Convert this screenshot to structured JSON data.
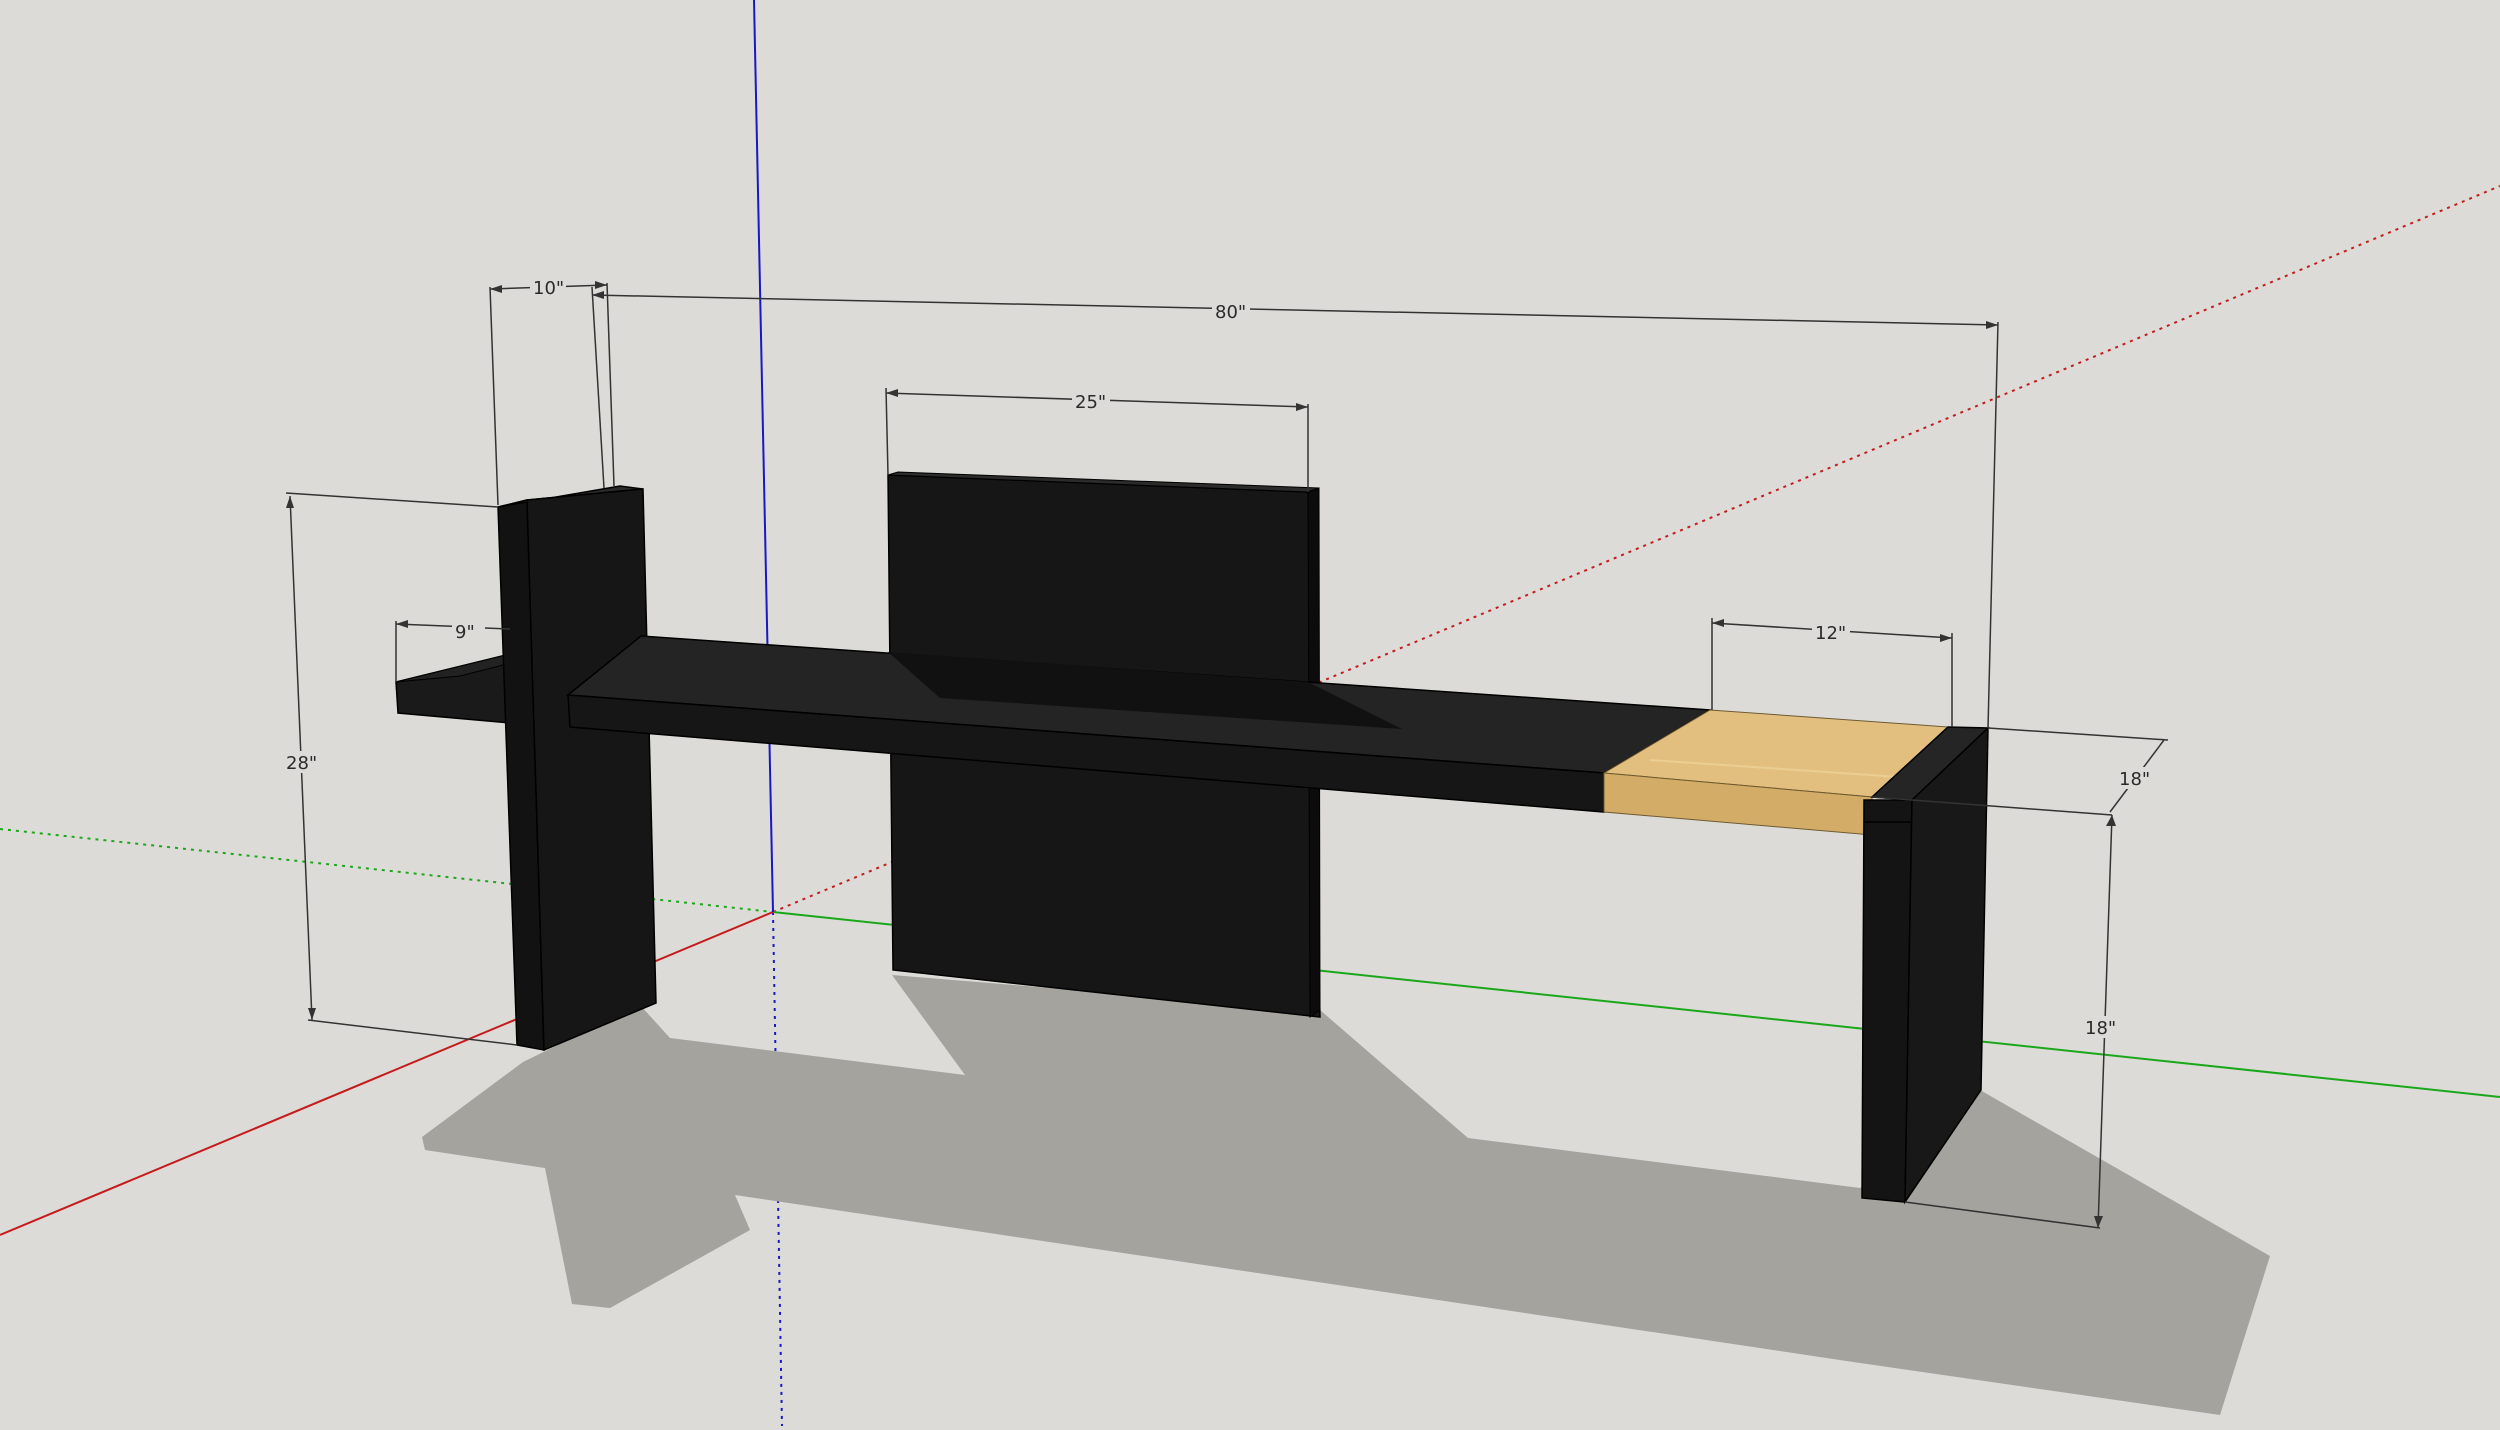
{
  "scene": {
    "background_color": "#dcdbd7",
    "shadow_color": "#a4a39e",
    "material_black": "#161616",
    "material_wood": "#e2bf7e",
    "axis_red": "#c61b1b",
    "axis_green": "#1aa81a",
    "axis_blue": "#1818c8"
  },
  "dimensions": {
    "leg_width": "10\"",
    "overall_length": "80\"",
    "panel_width": "25\"",
    "overhang": "9\"",
    "wood_insert_width": "12\"",
    "leg_height": "28\"",
    "depth": "18\"",
    "seat_height": "18\""
  }
}
